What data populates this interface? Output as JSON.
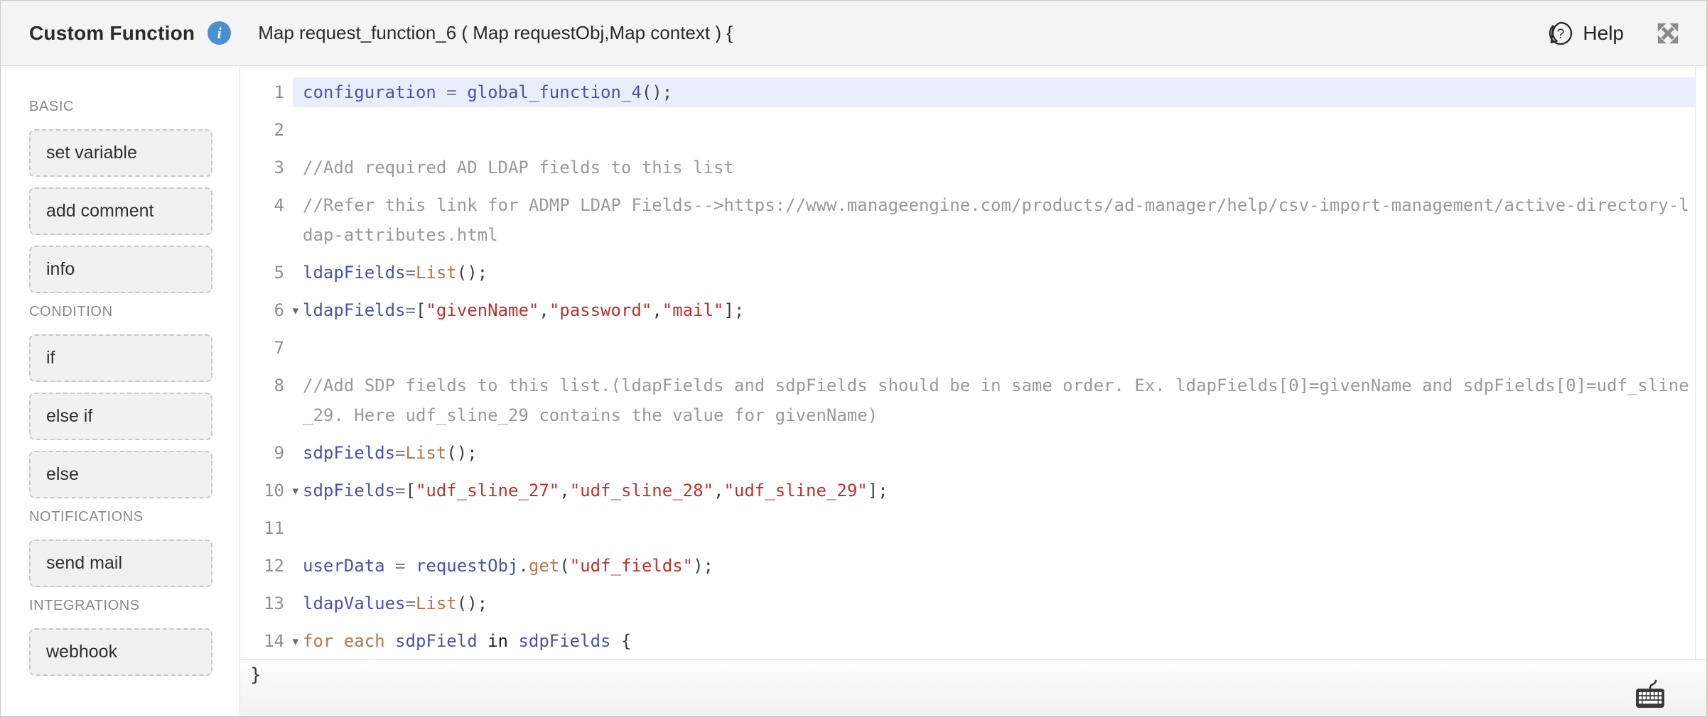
{
  "header": {
    "title": "Custom Function",
    "info_icon": "info-circle-icon",
    "signature": "Map request_function_6 ( Map requestObj,Map context ) {",
    "help_label": "Help",
    "help_icon": "question-bubble-icon",
    "expand_icon": "expand-arrows-icon",
    "info_icon_color": "#4a90cf"
  },
  "sidebar": {
    "sections": [
      {
        "label": "BASIC",
        "items": [
          "set variable",
          "add comment",
          "info"
        ]
      },
      {
        "label": "CONDITION",
        "items": [
          "if",
          "else if",
          "else"
        ]
      },
      {
        "label": "NOTIFICATIONS",
        "items": [
          "send mail"
        ]
      },
      {
        "label": "INTEGRATIONS",
        "items": [
          "webhook"
        ]
      }
    ]
  },
  "editor": {
    "colors": {
      "variable": "#4b51ad",
      "string": "#c22f2f",
      "function": "#b2784e",
      "keyword": "#b2784e",
      "keyword_dark": "#1b1b1b",
      "comment": "#9a9a9a",
      "operator": "#7d818c",
      "punct": "#3c4043",
      "active_line_bg": "#e9eefb",
      "line_number": "#8d9095"
    },
    "lines": [
      {
        "num": "1",
        "active": true,
        "segments": [
          [
            "v",
            "configuration"
          ],
          [
            "o",
            " = "
          ],
          [
            "v",
            "global_function_4"
          ],
          [
            "p",
            "();"
          ]
        ]
      },
      {
        "num": "2",
        "segments": []
      },
      {
        "num": "3",
        "segments": [
          [
            "c",
            "//Add required AD LDAP fields to this list"
          ]
        ]
      },
      {
        "num": "4",
        "segments": [
          [
            "c",
            "//Refer this link for ADMP LDAP Fields-->https://www.manageengine.com/products/ad-manager/help/csv-import-management/active-directory-ldap-attributes.html"
          ]
        ]
      },
      {
        "num": "5",
        "segments": [
          [
            "v",
            "ldapFields"
          ],
          [
            "o",
            "="
          ],
          [
            "f",
            "List"
          ],
          [
            "p",
            "();"
          ]
        ]
      },
      {
        "num": "6",
        "fold": true,
        "segments": [
          [
            "v",
            "ldapFields"
          ],
          [
            "o",
            "="
          ],
          [
            "p",
            "["
          ],
          [
            "s",
            "\"givenName\""
          ],
          [
            "p",
            ","
          ],
          [
            "s",
            "\"password\""
          ],
          [
            "p",
            ","
          ],
          [
            "s",
            "\"mail\""
          ],
          [
            "p",
            "];"
          ]
        ]
      },
      {
        "num": "7",
        "segments": []
      },
      {
        "num": "8",
        "segments": [
          [
            "c",
            "//Add SDP fields to this list.(ldapFields and sdpFields should be in same order. Ex. ldapFields[0]=givenName and sdpFields[0]=udf_sline_29. Here udf_sline_29 contains the value for givenName)"
          ]
        ]
      },
      {
        "num": "9",
        "segments": [
          [
            "v",
            "sdpFields"
          ],
          [
            "o",
            "="
          ],
          [
            "f",
            "List"
          ],
          [
            "p",
            "();"
          ]
        ]
      },
      {
        "num": "10",
        "fold": true,
        "segments": [
          [
            "v",
            "sdpFields"
          ],
          [
            "o",
            "="
          ],
          [
            "p",
            "["
          ],
          [
            "s",
            "\"udf_sline_27\""
          ],
          [
            "p",
            ","
          ],
          [
            "s",
            "\"udf_sline_28\""
          ],
          [
            "p",
            ","
          ],
          [
            "s",
            "\"udf_sline_29\""
          ],
          [
            "p",
            "];"
          ]
        ]
      },
      {
        "num": "11",
        "segments": []
      },
      {
        "num": "12",
        "segments": [
          [
            "v",
            "userData"
          ],
          [
            "o",
            " = "
          ],
          [
            "v",
            "requestObj"
          ],
          [
            "p",
            "."
          ],
          [
            "f",
            "get"
          ],
          [
            "p",
            "("
          ],
          [
            "s",
            "\"udf_fields\""
          ],
          [
            "p",
            ");"
          ]
        ]
      },
      {
        "num": "13",
        "segments": [
          [
            "v",
            "ldapValues"
          ],
          [
            "o",
            "="
          ],
          [
            "f",
            "List"
          ],
          [
            "p",
            "();"
          ]
        ]
      },
      {
        "num": "14",
        "fold": true,
        "segments": [
          [
            "k",
            "for each"
          ],
          [
            "o",
            " "
          ],
          [
            "v",
            "sdpField"
          ],
          [
            "kb",
            " in "
          ],
          [
            "v",
            "sdpFields"
          ],
          [
            "p",
            " {"
          ]
        ]
      }
    ],
    "fold_icon": "fold-arrow-icon"
  },
  "footer": {
    "closing_brace": "}",
    "keyboard_icon": "keyboard-shortcuts-icon"
  }
}
